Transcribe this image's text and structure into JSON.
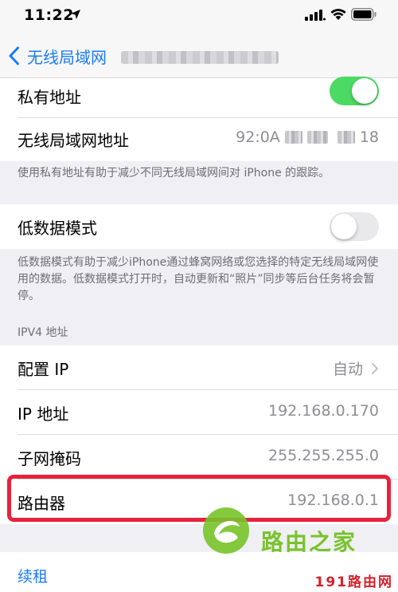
{
  "status_bar": {
    "time": "11:22"
  },
  "nav": {
    "back_label": "无线局域网"
  },
  "privacy_group": {
    "private_address_label": "私有地址",
    "private_address_on": true,
    "wifi_address_label": "无线局域网地址",
    "wifi_address_prefix": "92:0A",
    "wifi_address_suffix": "18",
    "footnote": "使用私有地址有助于减少不同无线局域网间对 iPhone 的跟踪。"
  },
  "low_data_group": {
    "label": "低数据模式",
    "on": false,
    "footnote": "低数据模式有助于减少iPhone通过蜂窝网络或您选择的特定无线局域网使用的数据。低数据模式打开时，自动更新和“照片”同步等后台任务将会暂停。"
  },
  "ipv4_group": {
    "header": "IPV4 地址",
    "configure_ip_label": "配置 IP",
    "configure_ip_value": "自动",
    "ip_label": "IP 地址",
    "ip_value": "192.168.0.170",
    "subnet_label": "子网掩码",
    "subnet_value": "255.255.255.0",
    "router_label": "路由器",
    "router_value": "192.168.0.1"
  },
  "renew_lease_label": "续租",
  "watermark": {
    "brand": "路由之家",
    "corner": "191路由网"
  },
  "colors": {
    "ios_blue": "#1b7cf6",
    "toggle_green": "#4cd964",
    "highlight_red": "#e8223d",
    "watermark_green": "#78c32a",
    "watermark_red": "#d61f28"
  },
  "icons": [
    "location-arrow-icon",
    "cellular-signal-icon",
    "wifi-icon",
    "battery-icon",
    "back-chevron-icon",
    "chevron-right-icon",
    "watermark-logo-icon"
  ]
}
